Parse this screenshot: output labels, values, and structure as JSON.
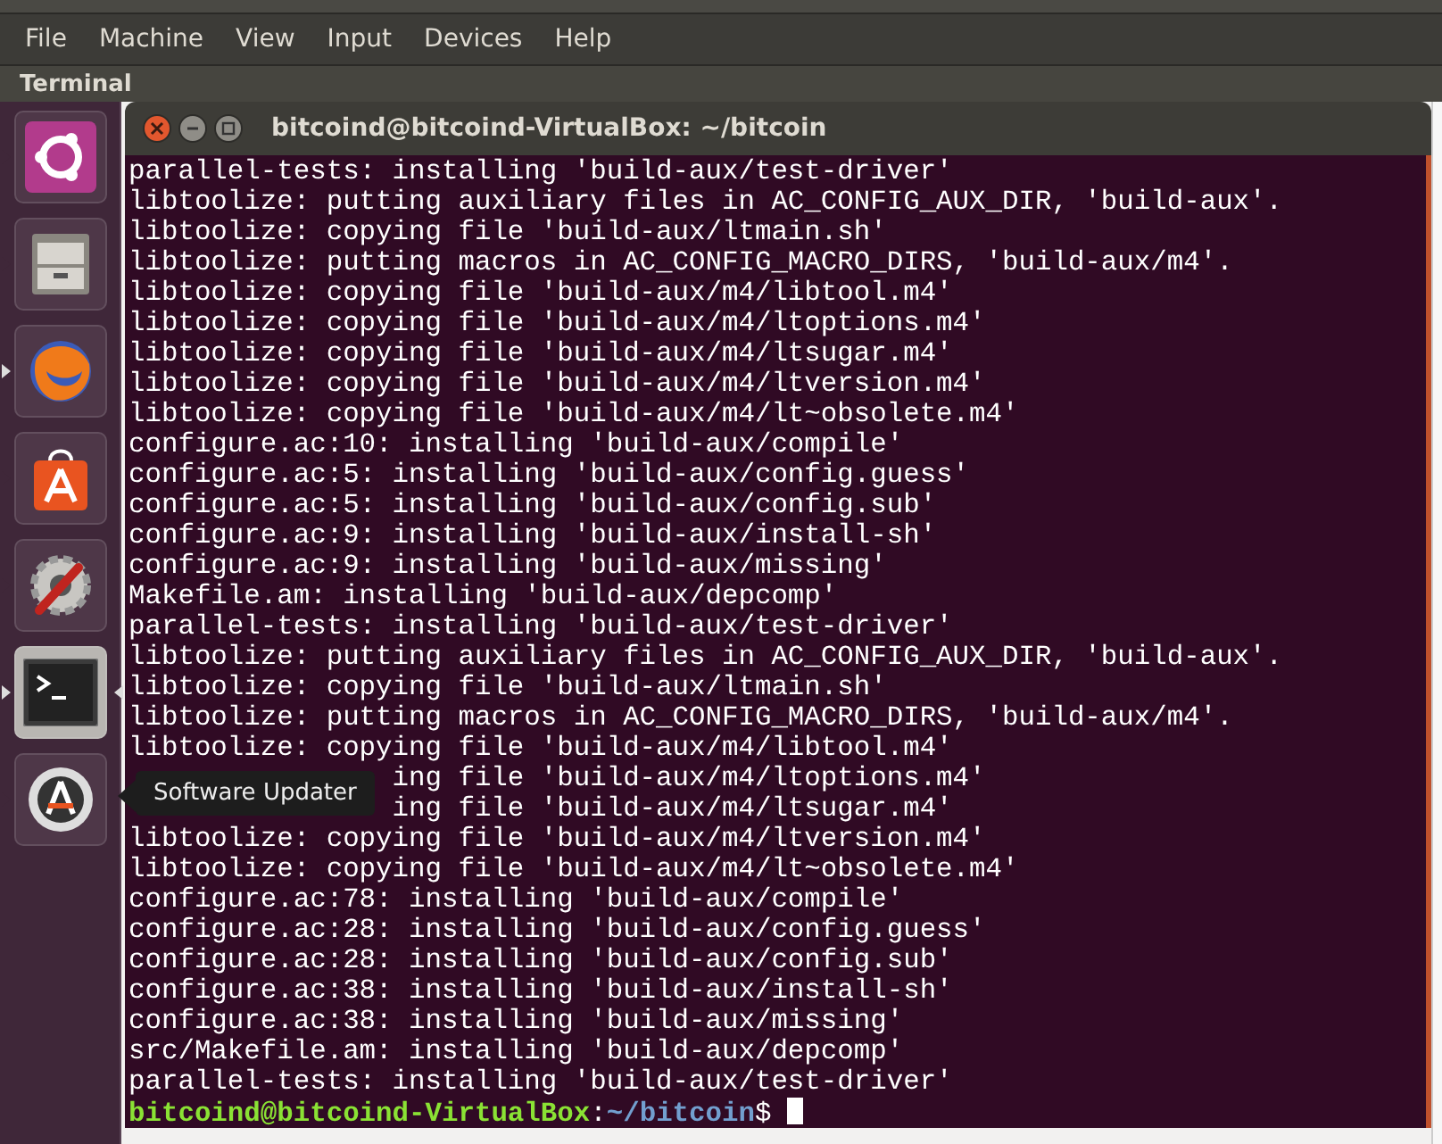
{
  "menu_bar": {
    "items": [
      "File",
      "Machine",
      "View",
      "Input",
      "Devices",
      "Help"
    ]
  },
  "app_title": "Terminal",
  "launcher": [
    {
      "kind": "ubuntu",
      "running": false,
      "focused": false
    },
    {
      "kind": "files",
      "running": false,
      "focused": false
    },
    {
      "kind": "firefox",
      "running": true,
      "focused": false
    },
    {
      "kind": "store",
      "running": false,
      "focused": false
    },
    {
      "kind": "settings",
      "running": false,
      "focused": false
    },
    {
      "kind": "terminal",
      "running": true,
      "focused": true
    },
    {
      "kind": "updater",
      "running": false,
      "focused": false
    }
  ],
  "tooltip": "Software Updater",
  "terminal": {
    "title": "bitcoind@bitcoind-VirtualBox: ~/bitcoin",
    "lines": [
      "parallel-tests: installing 'build-aux/test-driver'",
      "libtoolize: putting auxiliary files in AC_CONFIG_AUX_DIR, 'build-aux'.",
      "libtoolize: copying file 'build-aux/ltmain.sh'",
      "libtoolize: putting macros in AC_CONFIG_MACRO_DIRS, 'build-aux/m4'.",
      "libtoolize: copying file 'build-aux/m4/libtool.m4'",
      "libtoolize: copying file 'build-aux/m4/ltoptions.m4'",
      "libtoolize: copying file 'build-aux/m4/ltsugar.m4'",
      "libtoolize: copying file 'build-aux/m4/ltversion.m4'",
      "libtoolize: copying file 'build-aux/m4/lt~obsolete.m4'",
      "configure.ac:10: installing 'build-aux/compile'",
      "configure.ac:5: installing 'build-aux/config.guess'",
      "configure.ac:5: installing 'build-aux/config.sub'",
      "configure.ac:9: installing 'build-aux/install-sh'",
      "configure.ac:9: installing 'build-aux/missing'",
      "Makefile.am: installing 'build-aux/depcomp'",
      "parallel-tests: installing 'build-aux/test-driver'",
      "libtoolize: putting auxiliary files in AC_CONFIG_AUX_DIR, 'build-aux'.",
      "libtoolize: copying file 'build-aux/ltmain.sh'",
      "libtoolize: putting macros in AC_CONFIG_MACRO_DIRS, 'build-aux/m4'.",
      "libtoolize: copying file 'build-aux/m4/libtool.m4'",
      {
        "text": "ing file 'build-aux/m4/ltoptions.m4'",
        "covered": true
      },
      {
        "text": "ing file 'build-aux/m4/ltsugar.m4'",
        "covered": true
      },
      "libtoolize: copying file 'build-aux/m4/ltversion.m4'",
      "libtoolize: copying file 'build-aux/m4/lt~obsolete.m4'",
      "configure.ac:78: installing 'build-aux/compile'",
      "configure.ac:28: installing 'build-aux/config.guess'",
      "configure.ac:28: installing 'build-aux/config.sub'",
      "configure.ac:38: installing 'build-aux/install-sh'",
      "configure.ac:38: installing 'build-aux/missing'",
      "src/Makefile.am: installing 'build-aux/depcomp'",
      "parallel-tests: installing 'build-aux/test-driver'"
    ],
    "prompt": {
      "user_host": "bitcoind@bitcoind-VirtualBox",
      "separator": ":",
      "path": "~/bitcoin",
      "symbol": "$"
    }
  }
}
